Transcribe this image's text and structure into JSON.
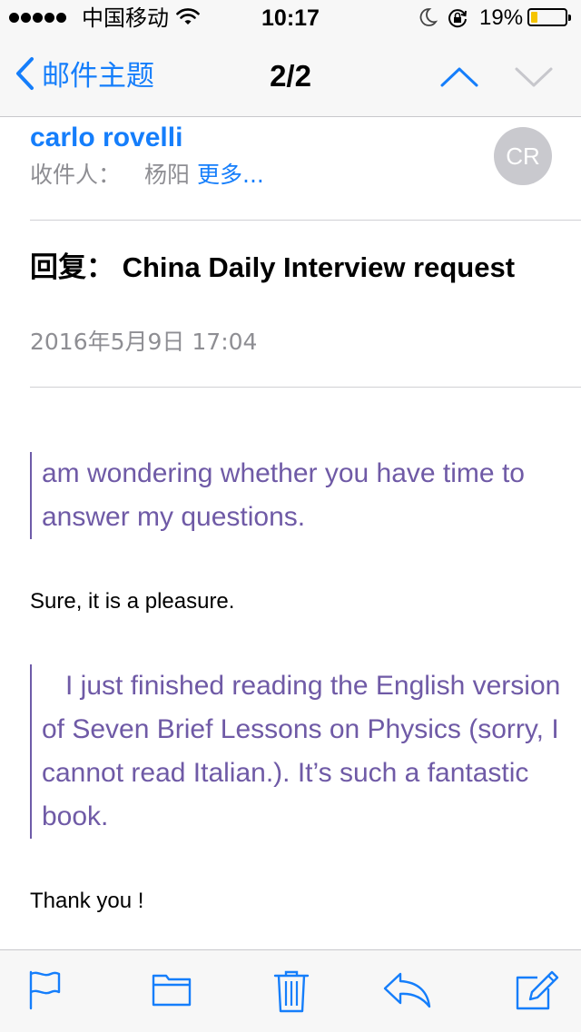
{
  "status_bar": {
    "carrier": "中国移动",
    "time": "10:17",
    "battery_percent": "19%",
    "battery_level": 0.19,
    "battery_color": "#f5c400",
    "icons": [
      "signal-dots-icon",
      "wifi-icon",
      "moon-icon",
      "rotation-lock-icon",
      "battery-icon"
    ]
  },
  "nav": {
    "back_label": "邮件主题",
    "title": "2/2",
    "accent_color": "#157efb",
    "icons": [
      "chevron-left-icon",
      "chevron-up-icon",
      "chevron-down-icon"
    ]
  },
  "header": {
    "sender_name": "carlo rovelli",
    "to_label": "收件人：",
    "to_name": "杨阳",
    "more_label": "更多...",
    "avatar_initials": "CR",
    "subject_prefix": "回复：",
    "subject_text": " China Daily Interview request",
    "date": "2016年5月9日 17:04"
  },
  "body": {
    "quote_color": "#6f5aa6",
    "quote_1": "am wondering whether you have time to answer my questions.",
    "reply_1": "Sure, it is a pleasure.",
    "quote_2": "I just finished reading the English version of Seven Brief Lessons on Physics (sorry, I cannot read Italian.). It’s such a fantastic book.",
    "reply_2": "Thank you !"
  },
  "toolbar": {
    "icons": [
      "flag-icon",
      "folder-icon",
      "trash-icon",
      "reply-icon",
      "compose-icon"
    ]
  }
}
